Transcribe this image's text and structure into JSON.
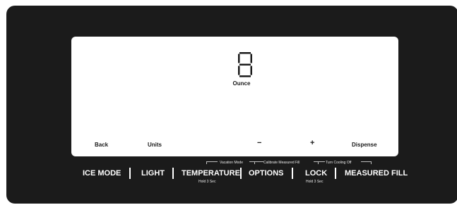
{
  "display": {
    "digit": "8",
    "unit": "Ounce"
  },
  "softkeys": {
    "back": "Back",
    "units": "Units",
    "minus": "−",
    "plus": "+",
    "dispense": "Dispense"
  },
  "hints": {
    "vacation_mode": "Vacation Mode",
    "calibrate_measured_fill": "Calibrate Measured Fill",
    "turn_cooling_off": "Turn Cooling Off"
  },
  "buttons": {
    "ice_mode": "ICE MODE",
    "light": "LIGHT",
    "temperature": "TEMPERATURE",
    "temperature_hold": "Hold 3 Sec",
    "options": "OPTIONS",
    "lock": "LOCK",
    "lock_hold": "Hold 3 Sec",
    "measured_fill": "MEASURED FILL"
  },
  "colors": {
    "panel": "#1b1b1b",
    "screen": "#ffffff",
    "text_light": "#ffffff"
  }
}
